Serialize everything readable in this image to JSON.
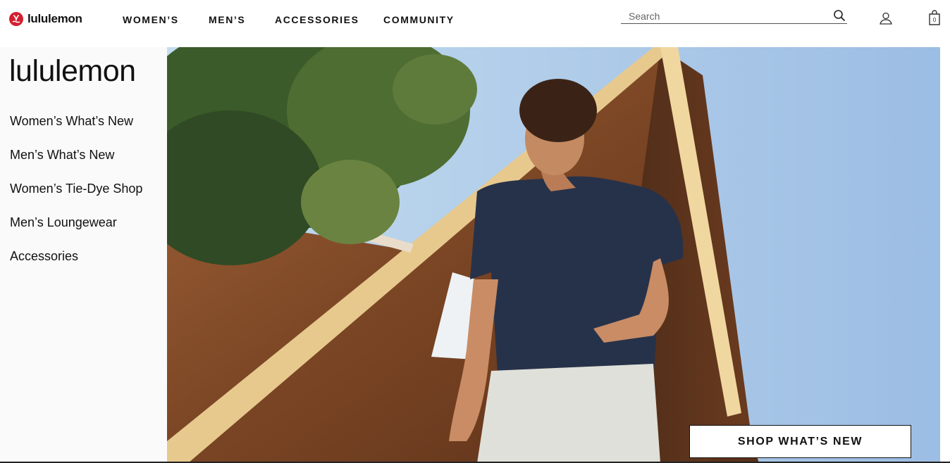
{
  "header": {
    "logo_text": "lululemon",
    "nav": [
      {
        "label": "WOMEN’S"
      },
      {
        "label": "MEN’S"
      },
      {
        "label": "ACCESSORIES"
      },
      {
        "label": "COMMUNITY"
      }
    ],
    "search": {
      "placeholder": "Search",
      "value": ""
    },
    "bag_count": "0",
    "icons": {
      "search": "search-icon",
      "account": "user-icon",
      "bag": "shopping-bag-icon"
    }
  },
  "sidebar": {
    "brand": "lululemon",
    "links": [
      {
        "label": "Women’s What’s New"
      },
      {
        "label": "Men’s What’s New"
      },
      {
        "label": "Women’s Tie-Dye Shop"
      },
      {
        "label": "Men’s Loungewear"
      },
      {
        "label": "Accessories"
      }
    ]
  },
  "hero": {
    "cta_label": "SHOP WHAT’S NEW"
  },
  "colors": {
    "brand_red": "#d22030",
    "sky": "#9ec3e9",
    "shirt": "#26324a",
    "wood": "#7a4524"
  }
}
